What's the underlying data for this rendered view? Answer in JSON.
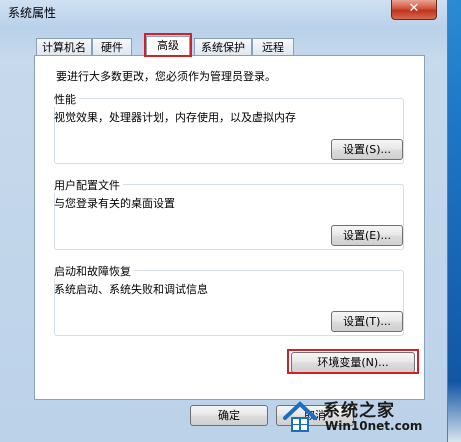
{
  "window": {
    "title": "系统属性",
    "close": "✕"
  },
  "tabs": [
    {
      "label": "计算机名"
    },
    {
      "label": "硬件"
    },
    {
      "label": "高级",
      "active": true
    },
    {
      "label": "系统保护"
    },
    {
      "label": "远程"
    }
  ],
  "admin_note": "要进行大多数更改，您必须作为管理员登录。",
  "performance": {
    "label": "性能",
    "desc": "视觉效果，处理器计划，内存使用，以及虚拟内存",
    "button": "设置(S)..."
  },
  "user_profiles": {
    "label": "用户配置文件",
    "desc": "与您登录有关的桌面设置",
    "button": "设置(E)..."
  },
  "startup_recovery": {
    "label": "启动和故障恢复",
    "desc": "系统启动、系统失败和调试信息",
    "button": "设置(T)..."
  },
  "env_vars_button": "环境变量(N)...",
  "footer": {
    "ok": "确定",
    "cancel": "取消"
  },
  "watermark": {
    "title": "系统之家",
    "url": "Win10net.com"
  },
  "colors": {
    "highlight": "#d0202a",
    "close_button": "#c0331d"
  }
}
